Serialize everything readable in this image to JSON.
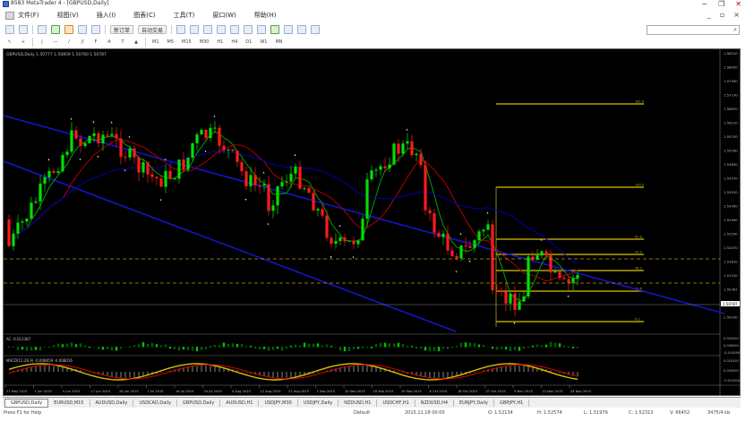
{
  "window": {
    "title": "8583 MetaTrader 4 - [GBPUSD,Daily]",
    "minimize": "−",
    "restore": "❐",
    "close": "✕"
  },
  "menu": [
    "文件(F)",
    "视图(V)",
    "插入(I)",
    "图表(C)",
    "工具(T)",
    "窗口(W)",
    "帮助(H)"
  ],
  "toolbar": {
    "new_order": "新订单",
    "auto_trading": "自动交易",
    "timeframes": [
      "M1",
      "M5",
      "M15",
      "M30",
      "H1",
      "H4",
      "D1",
      "W1",
      "MN"
    ]
  },
  "search": {
    "placeholder": ""
  },
  "chart": {
    "header": "GBPUSD,Daily  1.50777 1.50859 1.50760 1.50787",
    "ac_header": "AC -0.012387",
    "macd_header": "MACD(12,26,9) -0.008659 -0.008016",
    "date_labels": [
      "21 May 2015",
      "1 Jun 2015",
      "9 Jun 2015",
      "17 Jun 2015",
      "26 Jun 2015",
      "7 Jul 2015",
      "16 Jul 2015",
      "24 Jul 2015",
      "4 Aug 2015",
      "12 Aug 2015",
      "21 Aug 2015",
      "1 Sep 2015",
      "10 Sep 2015",
      "18 Sep 2015",
      "29 Sep 2015",
      "8 Oct 2015",
      "18 Oct 2015",
      "27 Oct 2015",
      "5 Nov 2015",
      "13 Nov 2015",
      "24 Nov 2015"
    ],
    "price_labels": [
      "1.58510",
      "1.58050",
      "1.57590",
      "1.57130",
      "1.56670",
      "1.56210",
      "1.55750",
      "1.55290",
      "1.54830",
      "1.54370",
      "1.53910",
      "1.53450",
      "1.52990",
      "1.52530",
      "1.52070",
      "1.51610",
      "1.51150",
      "1.50787",
      "1.50690",
      "1.50230"
    ],
    "current_price": "1.50787",
    "ac_labels": [
      "0.005200",
      "0.000000",
      "-0.014590"
    ],
    "macd_labels": [
      "0.010100",
      "0.000000",
      "-0.013300"
    ],
    "fib_labels": [
      "161.8",
      "100.0",
      "61.8",
      "50.0",
      "38.2",
      "23.6",
      "0.0"
    ],
    "colors": {
      "bull": "#00e000",
      "bear": "#ff1a1a",
      "channel": "#1414c8",
      "fib": "#b8a000",
      "ma_green": "#00a000",
      "ma_red": "#b00000",
      "ma_blue": "#0000b0",
      "macd_yellow": "#d4c000",
      "macd_red": "#e00000"
    }
  },
  "tabs": [
    "GBPUSD,Daily",
    "EURUSD,M15",
    "AUDUSD,Daily",
    "USDCAD,Daily",
    "GBPUSD,Daily",
    "AUDUSD,H1",
    "USDJPY,M30",
    "USDJPY,Daily",
    "NZDUSD,H1",
    "USDCHF,H1",
    "NZDUSD,H4",
    "EURJPY,Daily",
    "GBPJPY,H1"
  ],
  "status": {
    "help": "Press F1 for Help",
    "fields": [
      "Default",
      "2015.11.18 00:00",
      "O: 1.52134",
      "H: 1.52574",
      "L: 1.51979",
      "C: 1.52313",
      "V: 66452",
      "3475/4 kb"
    ]
  }
}
